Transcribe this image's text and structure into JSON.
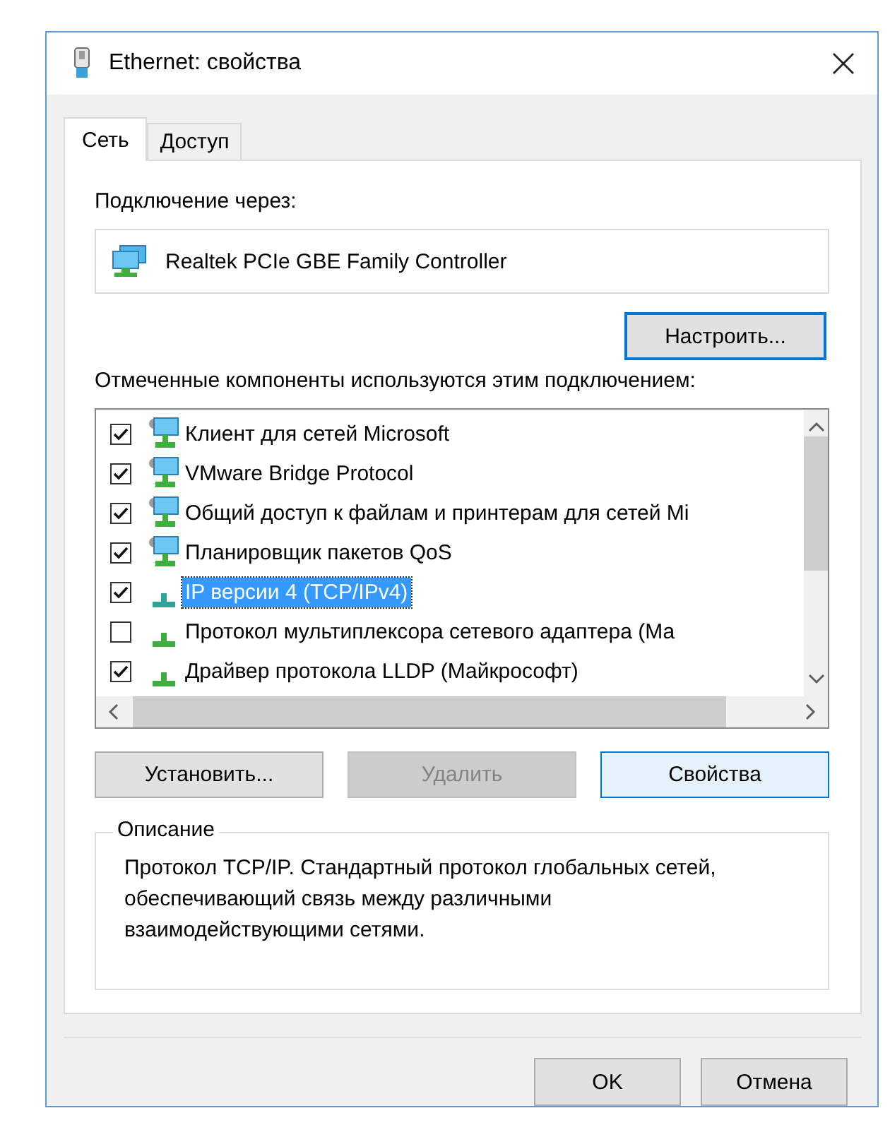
{
  "window": {
    "title": "Ethernet: свойства"
  },
  "tabs": [
    {
      "label": "Сеть",
      "selected": true
    },
    {
      "label": "Доступ",
      "selected": false
    }
  ],
  "connection": {
    "label": "Подключение через:",
    "adapter": "Realtek PCIe GBE Family Controller",
    "configure_button": {
      "label": "Настроить...",
      "focused": true
    }
  },
  "components": {
    "label": "Отмеченные компоненты используются этим подключением:",
    "items": [
      {
        "kind": "service",
        "name": "Клиент для сетей Microsoft",
        "checked": true,
        "selected": false
      },
      {
        "kind": "service",
        "name": "VMware Bridge Protocol",
        "checked": true,
        "selected": false
      },
      {
        "kind": "service",
        "name": "Общий доступ к файлам и принтерам для сетей Mi",
        "checked": true,
        "selected": false
      },
      {
        "kind": "service",
        "name": "Планировщик пакетов QoS",
        "checked": true,
        "selected": false
      },
      {
        "kind": "protocol",
        "name": "IP версии 4 (TCP/IPv4)",
        "checked": true,
        "selected": true
      },
      {
        "kind": "protocol",
        "name": "Протокол мультиплексора сетевого адаптера (Ма",
        "checked": false,
        "selected": false
      },
      {
        "kind": "protocol",
        "name": "Драйвер протокола LLDP (Майкрософт)",
        "checked": true,
        "selected": false
      }
    ]
  },
  "actions": [
    {
      "label": "Установить...",
      "disabled": false,
      "highlighted": false
    },
    {
      "label": "Удалить",
      "disabled": true,
      "highlighted": false
    },
    {
      "label": "Свойства",
      "disabled": false,
      "highlighted": true
    }
  ],
  "description": {
    "legend": "Описание",
    "text": "Протокол TCP/IP. Стандартный протокол глобальных сетей, обеспечивающий связь между различными взаимодействующими сетями."
  },
  "footer_buttons": [
    "OK",
    "Отмена"
  ]
}
